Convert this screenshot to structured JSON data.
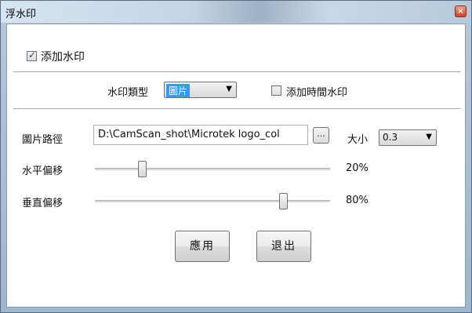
{
  "window": {
    "title": "浮水印",
    "close_glyph": "×"
  },
  "add_watermark": {
    "label": "添加水印",
    "checked": true
  },
  "type_row": {
    "label": "水印類型",
    "selected": "圖片",
    "add_time_label": "添加時間水印",
    "add_time_checked": false
  },
  "image_path": {
    "label": "圖片路徑",
    "value": "D:\\CamScan_shot\\Microtek logo_col",
    "browse_label": "...",
    "size_label": "大小",
    "size_value": "0.3"
  },
  "horizontal": {
    "label": "水平偏移",
    "value_text": "20%",
    "value": 0.2
  },
  "vertical": {
    "label": "垂直偏移",
    "value_text": "80%",
    "value": 0.8
  },
  "buttons": {
    "apply": "應用",
    "exit": "退出"
  }
}
